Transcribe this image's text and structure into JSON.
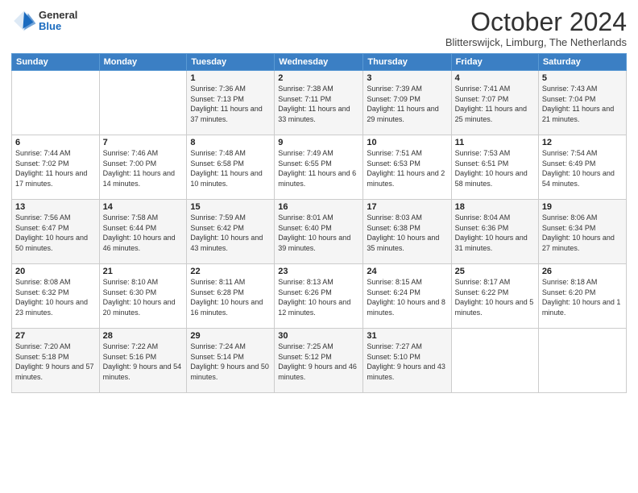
{
  "header": {
    "logo": {
      "general": "General",
      "blue": "Blue"
    },
    "title": "October 2024",
    "location": "Blitterswijck, Limburg, The Netherlands"
  },
  "weekdays": [
    "Sunday",
    "Monday",
    "Tuesday",
    "Wednesday",
    "Thursday",
    "Friday",
    "Saturday"
  ],
  "weeks": [
    [
      {
        "num": "",
        "sunrise": "",
        "sunset": "",
        "daylight": ""
      },
      {
        "num": "",
        "sunrise": "",
        "sunset": "",
        "daylight": ""
      },
      {
        "num": "1",
        "sunrise": "Sunrise: 7:36 AM",
        "sunset": "Sunset: 7:13 PM",
        "daylight": "Daylight: 11 hours and 37 minutes."
      },
      {
        "num": "2",
        "sunrise": "Sunrise: 7:38 AM",
        "sunset": "Sunset: 7:11 PM",
        "daylight": "Daylight: 11 hours and 33 minutes."
      },
      {
        "num": "3",
        "sunrise": "Sunrise: 7:39 AM",
        "sunset": "Sunset: 7:09 PM",
        "daylight": "Daylight: 11 hours and 29 minutes."
      },
      {
        "num": "4",
        "sunrise": "Sunrise: 7:41 AM",
        "sunset": "Sunset: 7:07 PM",
        "daylight": "Daylight: 11 hours and 25 minutes."
      },
      {
        "num": "5",
        "sunrise": "Sunrise: 7:43 AM",
        "sunset": "Sunset: 7:04 PM",
        "daylight": "Daylight: 11 hours and 21 minutes."
      }
    ],
    [
      {
        "num": "6",
        "sunrise": "Sunrise: 7:44 AM",
        "sunset": "Sunset: 7:02 PM",
        "daylight": "Daylight: 11 hours and 17 minutes."
      },
      {
        "num": "7",
        "sunrise": "Sunrise: 7:46 AM",
        "sunset": "Sunset: 7:00 PM",
        "daylight": "Daylight: 11 hours and 14 minutes."
      },
      {
        "num": "8",
        "sunrise": "Sunrise: 7:48 AM",
        "sunset": "Sunset: 6:58 PM",
        "daylight": "Daylight: 11 hours and 10 minutes."
      },
      {
        "num": "9",
        "sunrise": "Sunrise: 7:49 AM",
        "sunset": "Sunset: 6:55 PM",
        "daylight": "Daylight: 11 hours and 6 minutes."
      },
      {
        "num": "10",
        "sunrise": "Sunrise: 7:51 AM",
        "sunset": "Sunset: 6:53 PM",
        "daylight": "Daylight: 11 hours and 2 minutes."
      },
      {
        "num": "11",
        "sunrise": "Sunrise: 7:53 AM",
        "sunset": "Sunset: 6:51 PM",
        "daylight": "Daylight: 10 hours and 58 minutes."
      },
      {
        "num": "12",
        "sunrise": "Sunrise: 7:54 AM",
        "sunset": "Sunset: 6:49 PM",
        "daylight": "Daylight: 10 hours and 54 minutes."
      }
    ],
    [
      {
        "num": "13",
        "sunrise": "Sunrise: 7:56 AM",
        "sunset": "Sunset: 6:47 PM",
        "daylight": "Daylight: 10 hours and 50 minutes."
      },
      {
        "num": "14",
        "sunrise": "Sunrise: 7:58 AM",
        "sunset": "Sunset: 6:44 PM",
        "daylight": "Daylight: 10 hours and 46 minutes."
      },
      {
        "num": "15",
        "sunrise": "Sunrise: 7:59 AM",
        "sunset": "Sunset: 6:42 PM",
        "daylight": "Daylight: 10 hours and 43 minutes."
      },
      {
        "num": "16",
        "sunrise": "Sunrise: 8:01 AM",
        "sunset": "Sunset: 6:40 PM",
        "daylight": "Daylight: 10 hours and 39 minutes."
      },
      {
        "num": "17",
        "sunrise": "Sunrise: 8:03 AM",
        "sunset": "Sunset: 6:38 PM",
        "daylight": "Daylight: 10 hours and 35 minutes."
      },
      {
        "num": "18",
        "sunrise": "Sunrise: 8:04 AM",
        "sunset": "Sunset: 6:36 PM",
        "daylight": "Daylight: 10 hours and 31 minutes."
      },
      {
        "num": "19",
        "sunrise": "Sunrise: 8:06 AM",
        "sunset": "Sunset: 6:34 PM",
        "daylight": "Daylight: 10 hours and 27 minutes."
      }
    ],
    [
      {
        "num": "20",
        "sunrise": "Sunrise: 8:08 AM",
        "sunset": "Sunset: 6:32 PM",
        "daylight": "Daylight: 10 hours and 23 minutes."
      },
      {
        "num": "21",
        "sunrise": "Sunrise: 8:10 AM",
        "sunset": "Sunset: 6:30 PM",
        "daylight": "Daylight: 10 hours and 20 minutes."
      },
      {
        "num": "22",
        "sunrise": "Sunrise: 8:11 AM",
        "sunset": "Sunset: 6:28 PM",
        "daylight": "Daylight: 10 hours and 16 minutes."
      },
      {
        "num": "23",
        "sunrise": "Sunrise: 8:13 AM",
        "sunset": "Sunset: 6:26 PM",
        "daylight": "Daylight: 10 hours and 12 minutes."
      },
      {
        "num": "24",
        "sunrise": "Sunrise: 8:15 AM",
        "sunset": "Sunset: 6:24 PM",
        "daylight": "Daylight: 10 hours and 8 minutes."
      },
      {
        "num": "25",
        "sunrise": "Sunrise: 8:17 AM",
        "sunset": "Sunset: 6:22 PM",
        "daylight": "Daylight: 10 hours and 5 minutes."
      },
      {
        "num": "26",
        "sunrise": "Sunrise: 8:18 AM",
        "sunset": "Sunset: 6:20 PM",
        "daylight": "Daylight: 10 hours and 1 minute."
      }
    ],
    [
      {
        "num": "27",
        "sunrise": "Sunrise: 7:20 AM",
        "sunset": "Sunset: 5:18 PM",
        "daylight": "Daylight: 9 hours and 57 minutes."
      },
      {
        "num": "28",
        "sunrise": "Sunrise: 7:22 AM",
        "sunset": "Sunset: 5:16 PM",
        "daylight": "Daylight: 9 hours and 54 minutes."
      },
      {
        "num": "29",
        "sunrise": "Sunrise: 7:24 AM",
        "sunset": "Sunset: 5:14 PM",
        "daylight": "Daylight: 9 hours and 50 minutes."
      },
      {
        "num": "30",
        "sunrise": "Sunrise: 7:25 AM",
        "sunset": "Sunset: 5:12 PM",
        "daylight": "Daylight: 9 hours and 46 minutes."
      },
      {
        "num": "31",
        "sunrise": "Sunrise: 7:27 AM",
        "sunset": "Sunset: 5:10 PM",
        "daylight": "Daylight: 9 hours and 43 minutes."
      },
      {
        "num": "",
        "sunrise": "",
        "sunset": "",
        "daylight": ""
      },
      {
        "num": "",
        "sunrise": "",
        "sunset": "",
        "daylight": ""
      }
    ]
  ]
}
